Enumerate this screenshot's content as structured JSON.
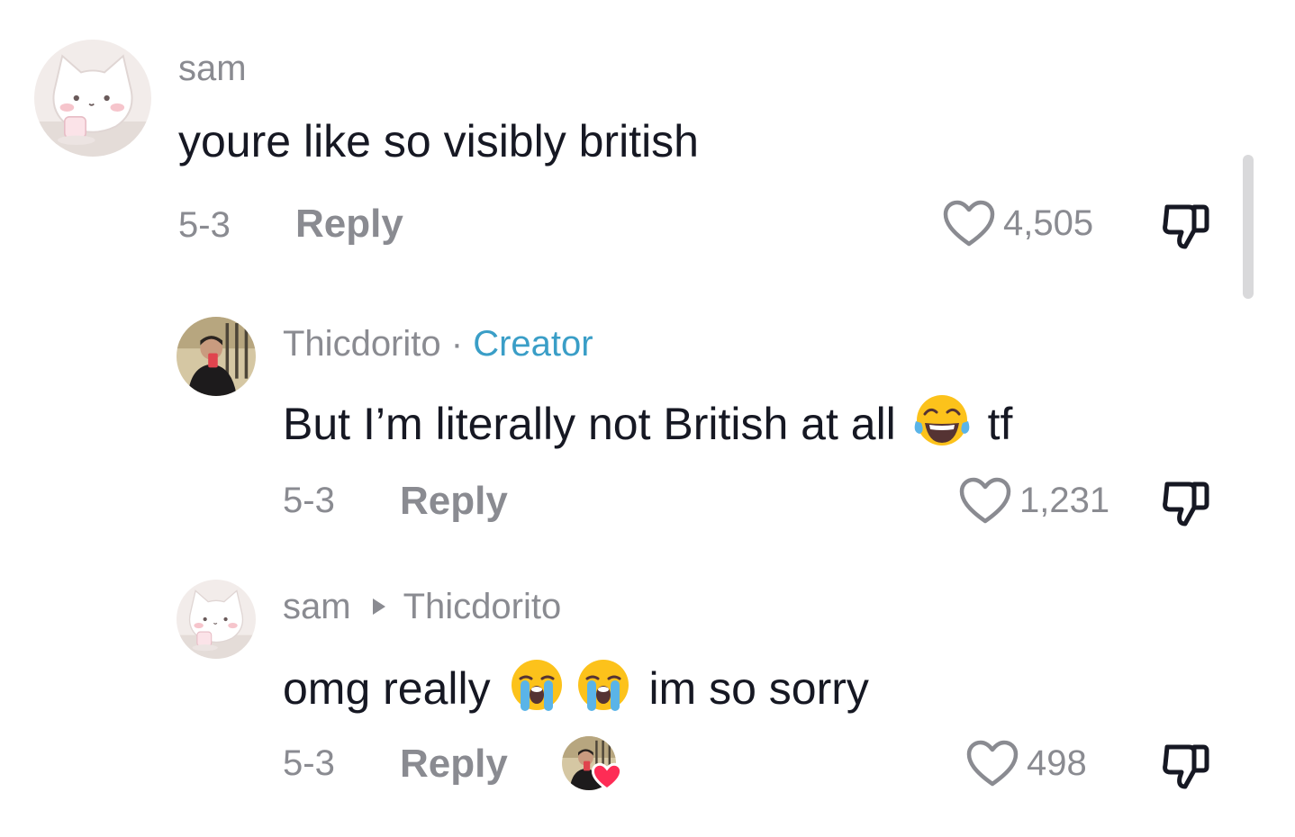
{
  "comments": [
    {
      "username": "sam",
      "text": "youre like so visibly british",
      "date": "5-3",
      "reply_label": "Reply",
      "likes": "4,505",
      "avatar_icon": "cat-avatar-icon"
    },
    {
      "username": "Thicdorito",
      "separator": "·",
      "badge": "Creator",
      "text_before": "But I’m literally not British at all",
      "emoji": "tears-of-joy-emoji",
      "text_after": "tf",
      "date": "5-3",
      "reply_label": "Reply",
      "likes": "1,231",
      "avatar_icon": "person-selfie-avatar-icon"
    },
    {
      "username": "sam",
      "reply_to": "Thicdorito",
      "text_before": "omg really",
      "emoji": "loudly-crying-emoji",
      "text_after": "im so sorry",
      "date": "5-3",
      "reply_label": "Reply",
      "likes": "498",
      "creator_liked_icon": "creator-liked-heart-icon"
    }
  ],
  "colors": {
    "text": "#161823",
    "muted": "#8a8b91",
    "creator": "#3a9ec7",
    "heart_badge": "#fe2c55"
  }
}
